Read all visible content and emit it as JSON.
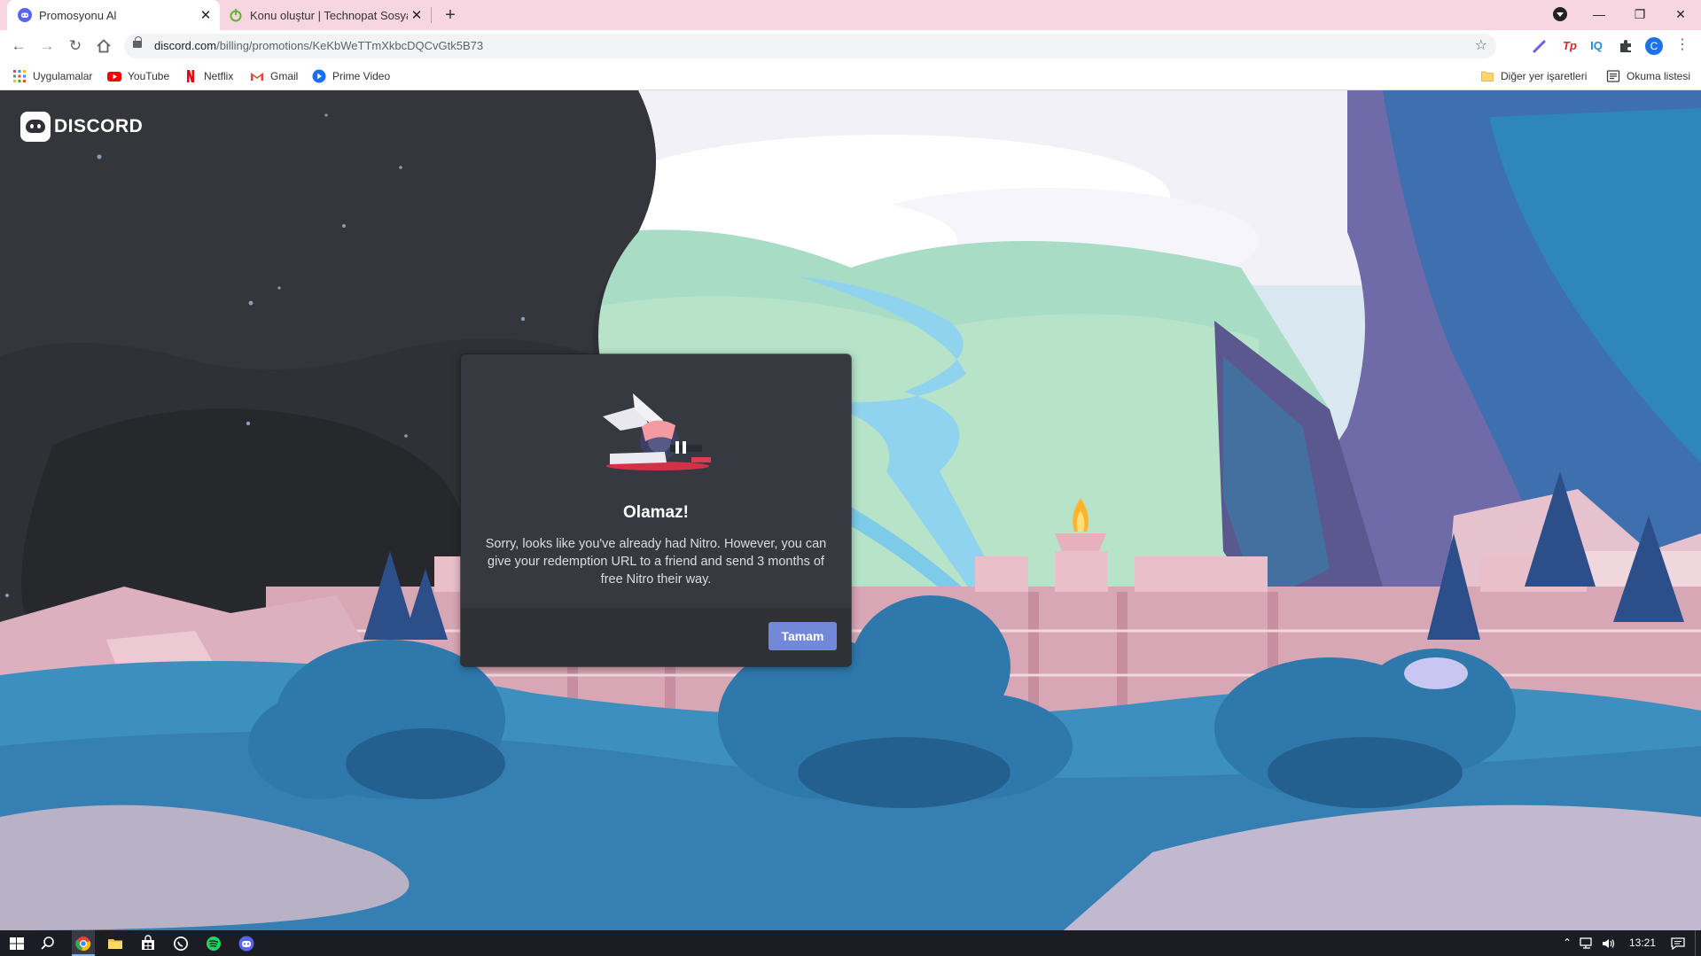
{
  "browser": {
    "tabs": [
      {
        "title": "Promosyonu Al",
        "active": true
      },
      {
        "title": "Konu oluştur | Technopat Sosyal",
        "active": false
      }
    ],
    "address": {
      "host": "discord.com",
      "path": "/billing/promotions/KeKbWeTTmXkbcDQCvGtk5B73"
    },
    "extensions": [
      "Tp",
      "IQ"
    ],
    "profile_initial": "C",
    "bookmarks": [
      {
        "label": "Uygulamalar",
        "icon": "apps-grid-icon"
      },
      {
        "label": "YouTube",
        "icon": "youtube-icon"
      },
      {
        "label": "Netflix",
        "icon": "netflix-icon"
      },
      {
        "label": "Gmail",
        "icon": "gmail-icon"
      },
      {
        "label": "Prime Video",
        "icon": "prime-video-icon"
      }
    ],
    "bookmarks_right": [
      {
        "label": "Diğer yer işaretleri",
        "icon": "folder-icon"
      },
      {
        "label": "Okuma listesi",
        "icon": "reading-list-icon"
      }
    ]
  },
  "page": {
    "brand": "DISCORD",
    "modal": {
      "title": "Olamaz!",
      "body": "Sorry, looks like you've already had Nitro. However, you can give your redemption URL to a friend and send 3 months of free Nitro their way.",
      "button": "Tamam"
    }
  },
  "taskbar": {
    "clock": "13:21"
  },
  "colors": {
    "blurple": "#7289da",
    "modal_bg": "#36393f",
    "footer_bg": "#2f3136",
    "tab_strip": "#f7d6e2"
  }
}
